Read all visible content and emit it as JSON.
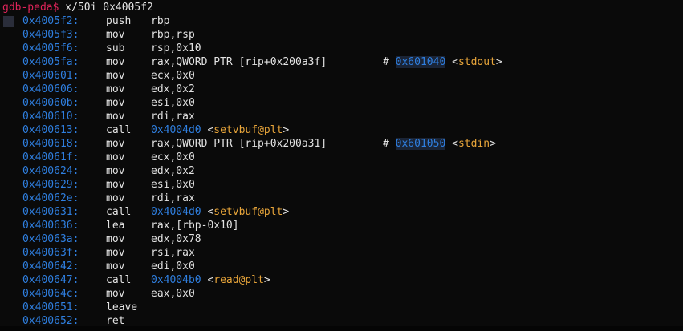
{
  "prompt": {
    "label": "gdb-peda$",
    "command": "x/50i 0x4005f2"
  },
  "colors": {
    "prompt": "#e0245a",
    "address": "#2f7fe0",
    "symbol": "#e8a53a",
    "text": "#e2e2e2",
    "background": "#0a0a0a"
  },
  "instructions": [
    {
      "addr": "0x4005f2:",
      "mnem": "push",
      "ops": "rbp",
      "current": true
    },
    {
      "addr": "0x4005f3:",
      "mnem": "mov",
      "ops": "rbp,rsp"
    },
    {
      "addr": "0x4005f6:",
      "mnem": "sub",
      "ops": "rsp,0x10"
    },
    {
      "addr": "0x4005fa:",
      "mnem": "mov",
      "ops": "rax,QWORD PTR [rip+0x200a3f]",
      "comment_hash": "#",
      "comment_addr": "0x601040",
      "comment_name": "stdout"
    },
    {
      "addr": "0x400601:",
      "mnem": "mov",
      "ops": "ecx,0x0"
    },
    {
      "addr": "0x400606:",
      "mnem": "mov",
      "ops": "edx,0x2"
    },
    {
      "addr": "0x40060b:",
      "mnem": "mov",
      "ops": "esi,0x0"
    },
    {
      "addr": "0x400610:",
      "mnem": "mov",
      "ops": "rdi,rax"
    },
    {
      "addr": "0x400613:",
      "mnem": "call",
      "target": "0x4004d0",
      "sym": "setvbuf@plt"
    },
    {
      "addr": "0x400618:",
      "mnem": "mov",
      "ops": "rax,QWORD PTR [rip+0x200a31]",
      "comment_hash": "#",
      "comment_addr": "0x601050",
      "comment_name": "stdin"
    },
    {
      "addr": "0x40061f:",
      "mnem": "mov",
      "ops": "ecx,0x0"
    },
    {
      "addr": "0x400624:",
      "mnem": "mov",
      "ops": "edx,0x2"
    },
    {
      "addr": "0x400629:",
      "mnem": "mov",
      "ops": "esi,0x0"
    },
    {
      "addr": "0x40062e:",
      "mnem": "mov",
      "ops": "rdi,rax"
    },
    {
      "addr": "0x400631:",
      "mnem": "call",
      "target": "0x4004d0",
      "sym": "setvbuf@plt"
    },
    {
      "addr": "0x400636:",
      "mnem": "lea",
      "ops": "rax,[rbp-0x10]"
    },
    {
      "addr": "0x40063a:",
      "mnem": "mov",
      "ops": "edx,0x78"
    },
    {
      "addr": "0x40063f:",
      "mnem": "mov",
      "ops": "rsi,rax"
    },
    {
      "addr": "0x400642:",
      "mnem": "mov",
      "ops": "edi,0x0"
    },
    {
      "addr": "0x400647:",
      "mnem": "call",
      "target": "0x4004b0",
      "sym": "read@plt"
    },
    {
      "addr": "0x40064c:",
      "mnem": "mov",
      "ops": "eax,0x0"
    },
    {
      "addr": "0x400651:",
      "mnem": "leave",
      "ops": ""
    },
    {
      "addr": "0x400652:",
      "mnem": "ret",
      "ops": ""
    }
  ]
}
